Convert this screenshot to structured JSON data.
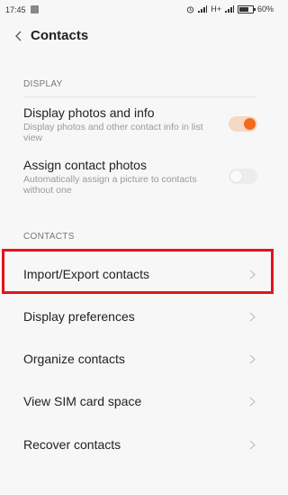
{
  "status_bar": {
    "time": "17:45",
    "network": "H+",
    "battery": "60%"
  },
  "header": {
    "title": "Contacts"
  },
  "display_section": {
    "heading": "DISPLAY",
    "items": [
      {
        "label": "Display photos and info",
        "description": "Display photos and other contact info in list view",
        "enabled": true
      },
      {
        "label": "Assign contact photos",
        "description": "Automatically assign a picture to contacts without one",
        "enabled": false
      }
    ]
  },
  "contacts_section": {
    "heading": "CONTACTS",
    "items": [
      {
        "label": "Import/Export contacts",
        "highlighted": true
      },
      {
        "label": "Display preferences"
      },
      {
        "label": "Organize contacts"
      },
      {
        "label": "View SIM card space"
      },
      {
        "label": "Recover contacts"
      }
    ]
  },
  "colors": {
    "accent": "#f26a1b",
    "highlight_box": "#e3131b",
    "background": "#f7f7f7"
  }
}
